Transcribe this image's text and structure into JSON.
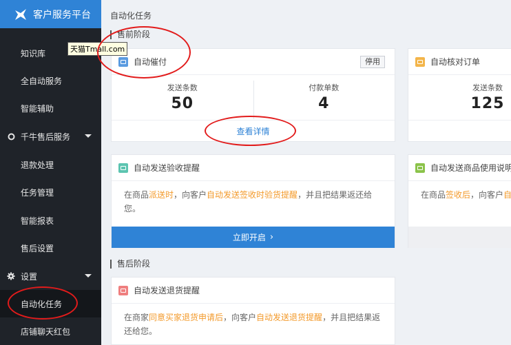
{
  "app": {
    "title": "客户服务平台"
  },
  "tooltip": "天猫Tmall.com",
  "sidebar": {
    "items": [
      {
        "label": "知识库"
      },
      {
        "label": "全自动服务"
      },
      {
        "label": "智能辅助"
      },
      {
        "label": "千牛售后服务",
        "group": true
      },
      {
        "label": "退款处理"
      },
      {
        "label": "任务管理"
      },
      {
        "label": "智能报表"
      },
      {
        "label": "售后设置"
      },
      {
        "label": "设置",
        "group": true
      },
      {
        "label": "自动化任务",
        "active": true
      },
      {
        "label": "店铺聊天红包"
      }
    ]
  },
  "main": {
    "page_title": "自动化任务",
    "presale_title": "售前阶段",
    "aftersale_title": "售后阶段",
    "card_payment": {
      "title": "自动催付",
      "stop_label": "停用",
      "stat1_label": "发送条数",
      "stat1_value": "50",
      "stat2_label": "付款单数",
      "stat2_value": "4",
      "detail_label": "查看详情"
    },
    "card_order_check": {
      "title": "自动核对订单",
      "stat1_label": "发送条数",
      "stat1_value": "125"
    },
    "card_receipt": {
      "title": "自动发送验收提醒",
      "desc_1": "在商品",
      "desc_2": "派送时",
      "desc_3": "，向客户",
      "desc_4": "自动发送签收时验货提醒",
      "desc_5": "，并且把结果返还给您。",
      "button": "立即开启"
    },
    "card_usage": {
      "title": "自动发送商品使用说明",
      "desc_1": "在商品",
      "desc_2": "签收后",
      "desc_3": "，向客户",
      "desc_4": "自"
    },
    "card_return": {
      "title": "自动发送退货提醒",
      "desc_1": "在商家",
      "desc_2": "同意买家退货申请后",
      "desc_3": "，向客户",
      "desc_4": "自动发送退货提醒",
      "desc_5": "，并且把结果返还给您。"
    }
  },
  "colors": {
    "accent": "#2f83d6",
    "highlight": "#f39a2b",
    "annotation": "#e21b1b",
    "sidebar_bg": "#1f2329"
  },
  "icons": {
    "logo": "bird-logo-icon",
    "settings": "gear-icon",
    "aftersale": "circle-icon",
    "caret": "caret-down-icon"
  }
}
